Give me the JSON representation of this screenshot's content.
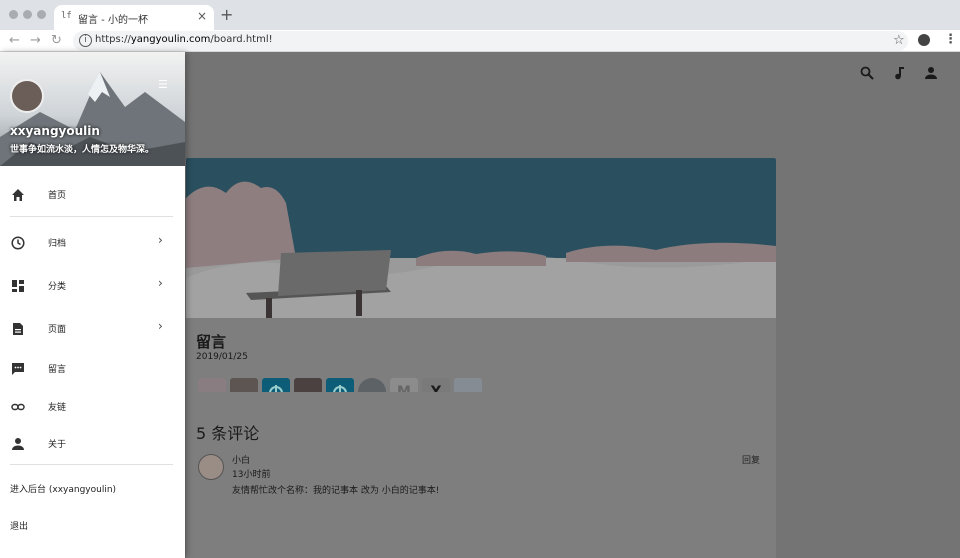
{
  "browser": {
    "tab_title": "留言 - 小的一杯",
    "tab_favicon": "lf",
    "tab_close": "×",
    "new_tab": "+",
    "url_scheme": "https://",
    "url_host": "yangyoulin.com",
    "url_path": "/board.html!",
    "icons": [
      "back-icon",
      "forward-icon",
      "reload-icon",
      "info-icon",
      "star-icon",
      "profile-icon",
      "menu-icon"
    ]
  },
  "appbar": {
    "icons": [
      "search-icon",
      "music-icon",
      "account-icon"
    ]
  },
  "drawer": {
    "name": "xxyangyoulin",
    "motto": "世事争如流水淡，人情怎及物华深。",
    "items": [
      {
        "label": "首页",
        "icon": "home-icon",
        "chevron": false
      },
      {
        "label": "归档",
        "icon": "clock-icon",
        "chevron": true
      },
      {
        "label": "分类",
        "icon": "dashboard-icon",
        "chevron": true
      },
      {
        "label": "页面",
        "icon": "document-icon",
        "chevron": true
      },
      {
        "label": "留言",
        "icon": "message-icon",
        "chevron": false
      },
      {
        "label": "友链",
        "icon": "link-icon",
        "chevron": false
      },
      {
        "label": "关于",
        "icon": "person-icon",
        "chevron": false
      }
    ],
    "admin": "进入后台 (xxyangyoulin)",
    "logout": "退出"
  },
  "post": {
    "title": "留言",
    "date": "2019/01/25",
    "avatars": [
      {
        "name": "avatar-1",
        "color": "#8a7d82"
      },
      {
        "name": "avatar-2",
        "color": "#5d5552"
      },
      {
        "name": "avatar-3",
        "color": "#0e5d78"
      },
      {
        "name": "avatar-4",
        "color": "#4a4140"
      },
      {
        "name": "avatar-5",
        "color": "#0e5d78"
      },
      {
        "name": "avatar-6",
        "color": "#5d6266"
      },
      {
        "name": "avatar-7",
        "color": "#8c8c8c"
      },
      {
        "name": "avatar-8",
        "color": "#7a7a7a"
      },
      {
        "name": "avatar-9",
        "color": "#868c94"
      }
    ]
  },
  "comments": {
    "title": "5 条评论",
    "items": [
      {
        "name": "小白",
        "time": "13小时前",
        "text": "友情帮忙改个名称：我的记事本 改为 小白的记事本!",
        "reply": "回复"
      }
    ]
  }
}
